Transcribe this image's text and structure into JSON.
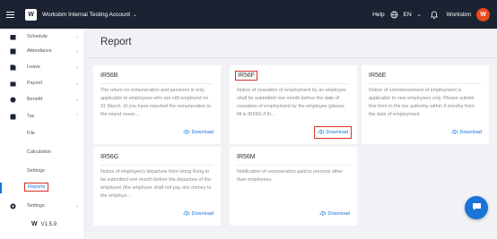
{
  "topbar": {
    "account": "Worksbm Internal Testing Account",
    "help": "Help",
    "language": "EN",
    "user": "Worksbm",
    "avatar_letter": "W"
  },
  "sidebar": {
    "items": [
      {
        "label": "Schedule",
        "icon": "calendar-icon"
      },
      {
        "label": "Attendance",
        "icon": "clock-icon"
      },
      {
        "label": "Leave",
        "icon": "leave-icon"
      },
      {
        "label": "Payroll",
        "icon": "wallet-icon"
      },
      {
        "label": "Benefit",
        "icon": "gift-icon"
      },
      {
        "label": "Tax",
        "icon": "tax-icon"
      }
    ],
    "tax_sub": [
      "File",
      "Calculation",
      "Settings",
      "Reports"
    ],
    "settings": "Settings",
    "version": "V1.5.9"
  },
  "page": {
    "title": "Report"
  },
  "cards": [
    {
      "title": "IR56B",
      "desc": "The return on remuneration and pensions is only applicable to employees who are still employed on 31 March. (if you have reported the remuneration to the inland reven...",
      "download": "Download"
    },
    {
      "title": "IR56F",
      "desc": "Notice of cessation of employment by an employee shall be submitted one month before the date of cessation of employment by the employee (please fill in IR56G if th...",
      "download": "Download"
    },
    {
      "title": "IR56E",
      "desc": "Notice of commencement of employment is applicable to new employees only. Please submit this form to the tax authority within 3 months from the date of employment.",
      "download": "Download"
    },
    {
      "title": "IR56G",
      "desc": "Notice of employee's departure from Hong Kong to be submitted one month before the departure of the employee (the employer shall not pay any money to the employe...",
      "download": "Download"
    },
    {
      "title": "IR56M",
      "desc": "Notification of remuneration paid to persons other than employees.",
      "download": "Download"
    }
  ],
  "colors": {
    "accent": "#1a73d9",
    "highlight": "#d8312a",
    "topbar": "#1b2333"
  }
}
